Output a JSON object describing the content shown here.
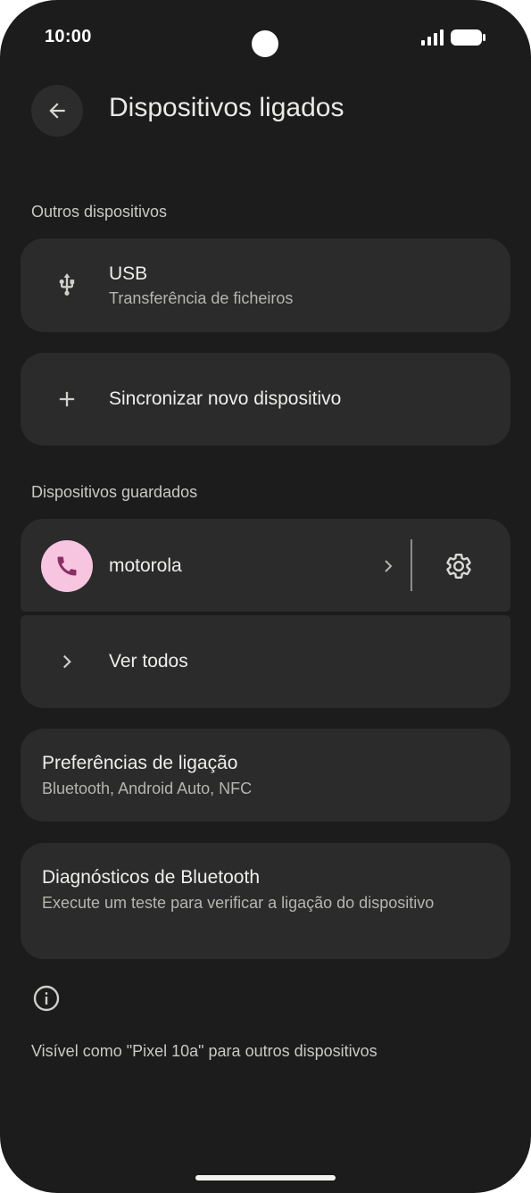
{
  "status_bar": {
    "time": "10:00",
    "icons": [
      "signal-icon",
      "battery-icon"
    ]
  },
  "header": {
    "title": "Dispositivos ligados",
    "back_icon": "arrow-back-icon"
  },
  "sections": {
    "other_devices": "Outros dispositivos",
    "saved_devices": "Dispositivos guardados"
  },
  "usb": {
    "title": "USB",
    "subtitle": "Transferência de ficheiros",
    "icon": "usb-icon"
  },
  "pair_new": {
    "label": "Sincronizar novo dispositivo",
    "icon": "plus-icon"
  },
  "saved_device": {
    "name": "motorola",
    "icon": "phone-icon",
    "settings_icon": "gear-icon"
  },
  "see_all": {
    "label": "Ver todos",
    "icon": "chevron-right-icon"
  },
  "connection_prefs": {
    "title": "Preferências de ligação",
    "subtitle": "Bluetooth, Android Auto, NFC"
  },
  "bt_diagnostics": {
    "title": "Diagnósticos de Bluetooth",
    "subtitle": "Execute um teste para verificar a ligação do dispositivo"
  },
  "footer": {
    "info_icon": "info-icon",
    "visibility_text": "Visível como \"Pixel 10a\" para outros dispositivos"
  },
  "colors": {
    "background": "#1b1c1b",
    "card": "#2a2b2a",
    "avatar": "#f7c5e0",
    "avatar_icon": "#8a2f63"
  }
}
